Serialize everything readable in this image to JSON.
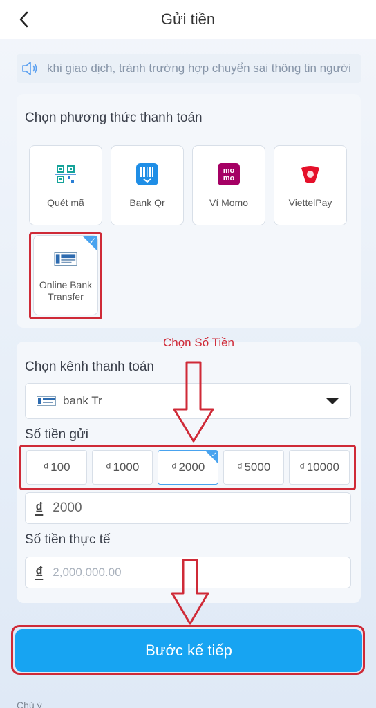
{
  "header": {
    "title": "Gửi tiền"
  },
  "notice": {
    "text": "khi giao dịch, tránh trường hợp chuyển sai thông tin người"
  },
  "payment": {
    "section_title": "Chọn phương thức thanh toán",
    "methods": [
      {
        "label": "Quét mã",
        "icon": "qr-scan-icon"
      },
      {
        "label": "Bank Qr",
        "icon": "bank-qr-icon"
      },
      {
        "label": "Ví Momo",
        "icon": "momo-icon"
      },
      {
        "label": "ViettelPay",
        "icon": "viettelpay-icon"
      },
      {
        "label": "Online Bank Transfer",
        "icon": "bank-transfer-icon",
        "selected": true
      }
    ]
  },
  "annotation": {
    "text": "Chọn Số Tiền"
  },
  "channel": {
    "section_title": "Chọn kênh thanh toán",
    "selected": "bank Tr"
  },
  "amount": {
    "section_title": "Số tiền gửi",
    "currency_symbol": "₫",
    "options": [
      "100",
      "1000",
      "2000",
      "5000",
      "10000"
    ],
    "selected": "2000",
    "input_value": "2000"
  },
  "actual": {
    "section_title": "Số tiền thực tế",
    "placeholder": "2,000,000.00"
  },
  "next_button": {
    "label": "Bước kế tiếp"
  },
  "footer": {
    "note_label": "Chú ý"
  },
  "colors": {
    "accent": "#17a4f2",
    "annotation_red": "#cf2a37"
  }
}
